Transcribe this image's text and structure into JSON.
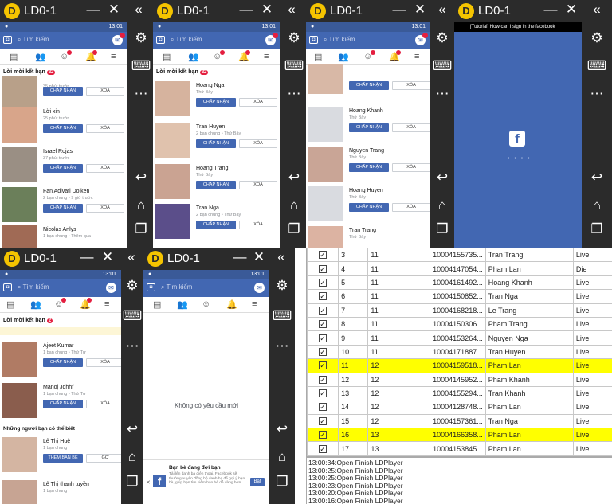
{
  "windows": [
    {
      "title": "LD0-1"
    },
    {
      "title": "LD0-1"
    },
    {
      "title": "LD0-1"
    },
    {
      "title": "LD0-1"
    },
    {
      "title": "LD0-1"
    },
    {
      "title": "LD0-1"
    }
  ],
  "status_time": "13:01",
  "search_placeholder": "Tìm kiếm",
  "friend_requests_label": "Lời mời kết bạn",
  "accept_label": "CHẤP NHẬN",
  "delete_label": "XÓA",
  "add_friend_label": "THÊM BẠN BÈ",
  "remove_label": "GỠ",
  "w1": {
    "count": "22",
    "rows": [
      {
        "name": "",
        "sub": "35 phút trước"
      },
      {
        "name": "Lời xin",
        "sub": "25 phút trước"
      },
      {
        "name": "Israel Rojas",
        "sub": "37 phút trước"
      },
      {
        "name": "Fan Adivati Dolken",
        "sub": "2 bạn chung • 9 giờ trước"
      },
      {
        "name": "Nicolas Anlys",
        "sub": "1 bạn chung • Thêm qua"
      }
    ]
  },
  "w2": {
    "count": "22",
    "rows": [
      {
        "name": "Hoang Nga",
        "sub": "Thứ Bảy"
      },
      {
        "name": "Tran Huyen",
        "sub": "2 bạn chung • Thứ Bảy"
      },
      {
        "name": "Hoang Trang",
        "sub": "Thứ Bảy"
      },
      {
        "name": "Tran Nga",
        "sub": "2 bạn chung • Thứ Bảy"
      }
    ]
  },
  "w3": {
    "rows": [
      {
        "name": "",
        "sub": ""
      },
      {
        "name": "Hoang Khanh",
        "sub": "Thứ Bảy"
      },
      {
        "name": "Nguyen Trang",
        "sub": "Thứ Bảy"
      },
      {
        "name": "Hoang Huyen",
        "sub": "Thứ Bảy"
      },
      {
        "name": "Tran Trang",
        "sub": "Thứ Bảy"
      }
    ]
  },
  "w4": {
    "banner": "[Tutorial] How can I sign in the facebook"
  },
  "w5": {
    "count": "2",
    "rows": [
      {
        "name": "Ajeet Kumar",
        "sub": "1 bạn chung • Thứ Tư"
      },
      {
        "name": "Manoj Jdhhf",
        "sub": "1 bạn chung • Thứ Tư"
      }
    ],
    "pymk": "Những người bạn có thể biết",
    "pymk_rows": [
      {
        "name": "Lê Thị Huệ",
        "sub": "1 bạn chung"
      },
      {
        "name": "Lê Thị thanh tuyền",
        "sub": "1 bạn chung"
      }
    ]
  },
  "w6": {
    "empty": "Không có yêu cầu mới",
    "promo_title": "Bạn bè đang đợi bạn",
    "promo_text": "Tải lên danh bạ điện thoại. Facebook sẽ thường xuyên đồng bộ danh bạ để gợi ý bạn bè, giúp bạn tìm kiếm bạn bè dễ dàng hơn",
    "promo_btn": "Bật"
  },
  "grid": {
    "rows": [
      {
        "n": "3",
        "k": "11",
        "id": "10004155735...",
        "name": "Tran Trang",
        "st": "Live",
        "hl": false
      },
      {
        "n": "4",
        "k": "11",
        "id": "10004147054...",
        "name": "Pham Lan",
        "st": "Die",
        "hl": false
      },
      {
        "n": "5",
        "k": "11",
        "id": "10004161492...",
        "name": "Hoang Khanh",
        "st": "Live",
        "hl": false
      },
      {
        "n": "6",
        "k": "11",
        "id": "10004150852...",
        "name": "Tran Nga",
        "st": "Live",
        "hl": false
      },
      {
        "n": "7",
        "k": "11",
        "id": "10004168218...",
        "name": "Le Trang",
        "st": "Live",
        "hl": false
      },
      {
        "n": "8",
        "k": "11",
        "id": "10004150306...",
        "name": "Pham Trang",
        "st": "Live",
        "hl": false
      },
      {
        "n": "9",
        "k": "11",
        "id": "10004153264...",
        "name": "Nguyen Nga",
        "st": "Live",
        "hl": false
      },
      {
        "n": "10",
        "k": "11",
        "id": "10004171887...",
        "name": "Tran Huyen",
        "st": "Live",
        "hl": false
      },
      {
        "n": "11",
        "k": "12",
        "id": "10004159518...",
        "name": "Pham Lan",
        "st": "Live",
        "hl": true
      },
      {
        "n": "12",
        "k": "12",
        "id": "10004145952...",
        "name": "Pham Khanh",
        "st": "Live",
        "hl": false
      },
      {
        "n": "13",
        "k": "12",
        "id": "10004155294...",
        "name": "Tran Khanh",
        "st": "Live",
        "hl": false
      },
      {
        "n": "14",
        "k": "12",
        "id": "10004128748...",
        "name": "Pham Lan",
        "st": "Live",
        "hl": false
      },
      {
        "n": "15",
        "k": "12",
        "id": "10004157361...",
        "name": "Tran Nga",
        "st": "Live",
        "hl": false
      },
      {
        "n": "16",
        "k": "13",
        "id": "10004166358...",
        "name": "Pham Lan",
        "st": "Live",
        "hl": true
      },
      {
        "n": "17",
        "k": "13",
        "id": "10004153845...",
        "name": "Pham Lan",
        "st": "Live",
        "hl": false
      }
    ]
  },
  "log": [
    "13:00:34:Open Finish LDPlayer",
    "13:00:25:Open Finish LDPlayer",
    "13:00:25:Open Finish LDPlayer",
    "13:00:23:Open Finish LDPlayer",
    "13:00:20:Open Finish LDPlayer",
    "13:00:16:Open Finish LDPlayer"
  ],
  "colors": {
    "fb_blue": "#4267b2",
    "highlight": "#ffff00",
    "badge": "#e41e3f",
    "emulator_frame": "#2b2b2b"
  }
}
